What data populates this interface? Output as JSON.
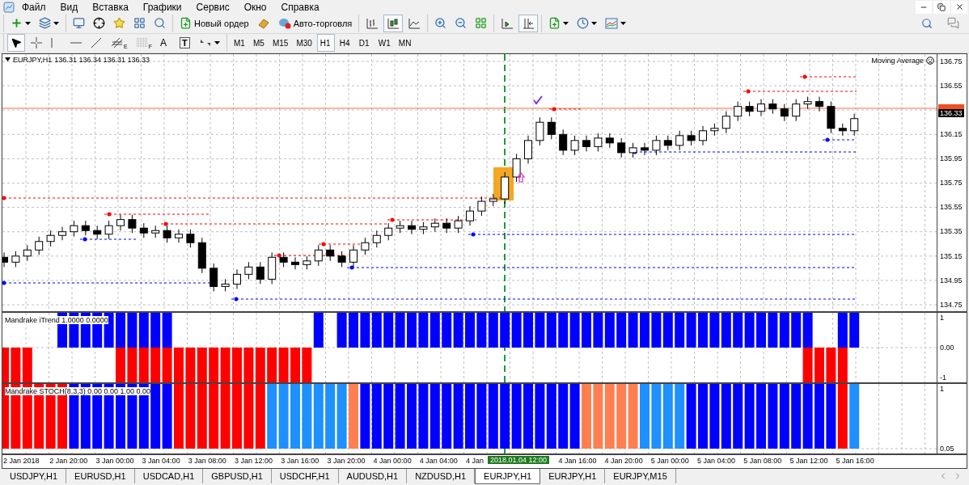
{
  "menu": [
    "Файл",
    "Вид",
    "Вставка",
    "Графики",
    "Сервис",
    "Окно",
    "Справка"
  ],
  "toolbar": {
    "order_button": "Новый ордер",
    "autotrading_button": "Авто-торговля",
    "chart_types": [
      {
        "kind": "bars",
        "selected": false
      },
      {
        "kind": "candles",
        "selected": true
      },
      {
        "kind": "line",
        "selected": false
      }
    ],
    "chart_shift": {
      "on": true
    }
  },
  "drawing_tools": [
    {
      "kind": "cursor",
      "selected": true
    },
    {
      "kind": "crosshair",
      "selected": false
    },
    {
      "kind": "vline",
      "selected": false
    },
    {
      "kind": "hline",
      "selected": false
    },
    {
      "kind": "trend",
      "selected": false
    },
    {
      "kind": "channel",
      "glyph": "E",
      "selected": false
    },
    {
      "kind": "fibo",
      "glyph": "F",
      "selected": false
    },
    {
      "kind": "text",
      "glyph": "A",
      "selected": false
    },
    {
      "kind": "label",
      "glyph": "T",
      "selected": false
    },
    {
      "kind": "arrows",
      "selected": false
    }
  ],
  "timeframes": [
    {
      "label": "M1",
      "selected": false
    },
    {
      "label": "M5",
      "selected": false
    },
    {
      "label": "M15",
      "selected": false
    },
    {
      "label": "M30",
      "selected": false
    },
    {
      "label": "H1",
      "selected": true
    },
    {
      "label": "H4",
      "selected": false
    },
    {
      "label": "D1",
      "selected": false
    },
    {
      "label": "W1",
      "selected": false
    },
    {
      "label": "MN",
      "selected": false
    }
  ],
  "chart": {
    "title": "EURJPY,H1",
    "ohlc": "136.31 136.34 136.31 136.33",
    "expert": "Moving Average",
    "current_price": "136.33",
    "price_labels": [
      "136.75",
      "136.55",
      "136.15",
      "135.95",
      "135.75",
      "135.55",
      "135.35",
      "135.15",
      "134.95",
      "134.75"
    ],
    "time_labels": [
      "2 Jan 2018",
      "2 Jan 20:00",
      "3 Jan 00:00",
      "3 Jan 04:00",
      "3 Jan 08:00",
      "3 Jan 12:00",
      "3 Jan 16:00",
      "3 Jan 20:00",
      "4 Jan 00:00",
      "4 Jan 04:00",
      "4 Jan",
      "4 Jan 16:00",
      "4 Jan 20:00",
      "5 Jan 00:00",
      "5 Jan 04:00",
      "5 Jan 08:00",
      "5 Jan 12:00",
      "5 Jan 16:00"
    ],
    "cursor_time": "2018.01.04 12:00"
  },
  "indicators": [
    {
      "kind": "trend",
      "label": "Mandrake iTrend 1.0000 0.0000",
      "scale": [
        "1",
        "0.00",
        "-1"
      ]
    },
    {
      "kind": "stoch",
      "label": "Mandrake STOCH(8,3,3) 0.00 0.00 1.00 0.00",
      "scale": [
        "1",
        "0.05"
      ]
    }
  ],
  "tabs": [
    {
      "label": "USDJPY,H1",
      "selected": false
    },
    {
      "label": "EURUSD,H1",
      "selected": false
    },
    {
      "label": "USDCAD,H1",
      "selected": false
    },
    {
      "label": "GBPUSD,H1",
      "selected": false
    },
    {
      "label": "USDCHF,H1",
      "selected": false
    },
    {
      "label": "AUDUSD,H1",
      "selected": false
    },
    {
      "label": "NZDUSD,H1",
      "selected": false
    },
    {
      "label": "EURJPY,H1",
      "selected": true
    },
    {
      "label": "EURJPY,H1",
      "selected": false
    },
    {
      "label": "EURJPY,M15",
      "selected": false
    }
  ]
}
